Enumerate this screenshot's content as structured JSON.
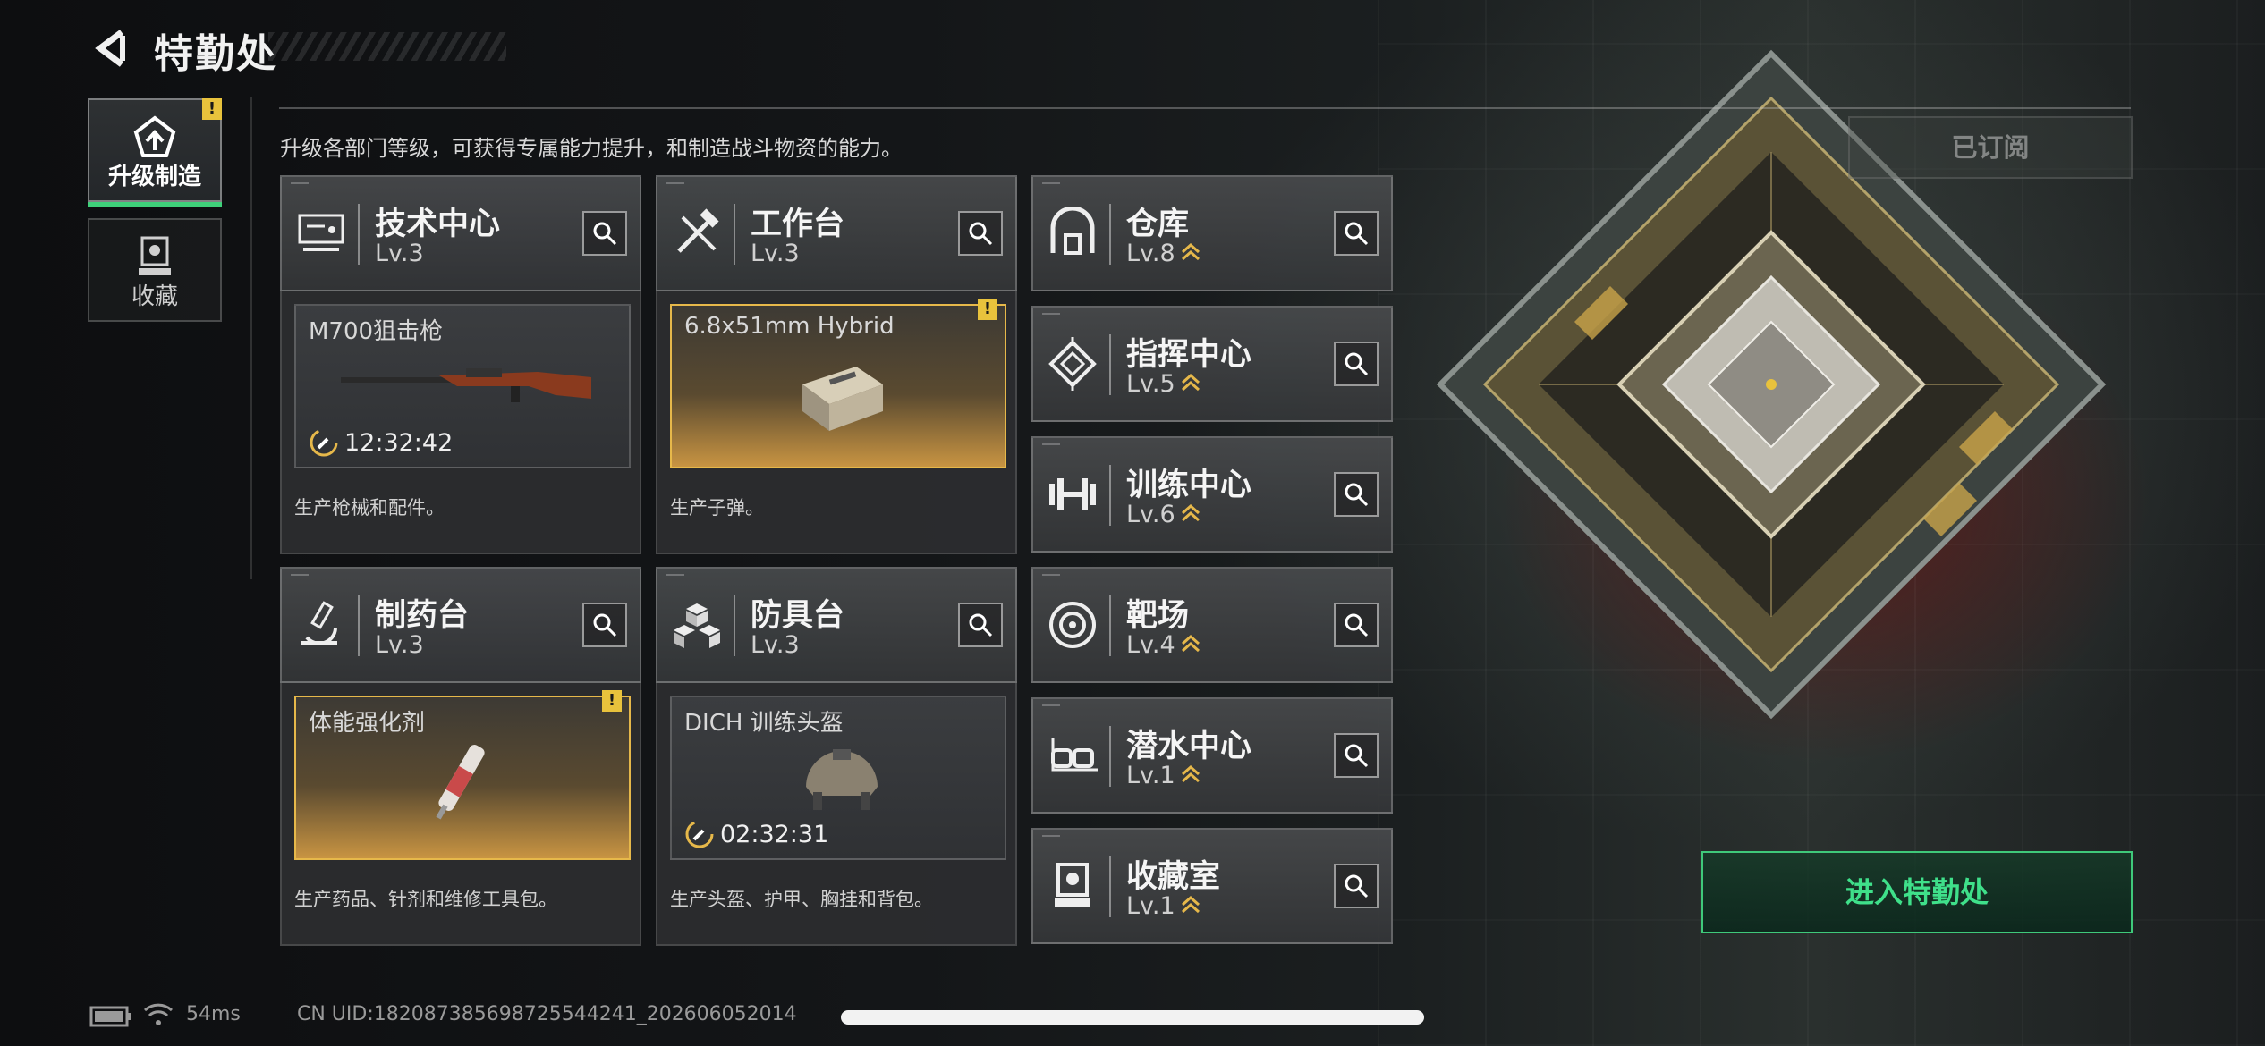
{
  "header": {
    "title": "特勤处"
  },
  "nav": [
    {
      "label": "升级制造",
      "active": true,
      "badge": "!",
      "icon": "upgrade-gear-icon"
    },
    {
      "label": "收藏",
      "active": false,
      "icon": "collection-icon"
    }
  ],
  "description": "升级各部门等级，可获得专属能力提升，和制造战斗物资的能力。",
  "departments": [
    {
      "name": "技术中心",
      "level": "Lv.3",
      "icon": "computer-icon"
    },
    {
      "name": "工作台",
      "level": "Lv.3",
      "icon": "tools-icon"
    },
    {
      "name": "仓库",
      "level": "Lv.8",
      "icon": "warehouse-icon"
    },
    {
      "name": "指挥中心",
      "level": "Lv.5",
      "icon": "command-icon"
    },
    {
      "name": "训练中心",
      "level": "Lv.6",
      "icon": "dumbbell-icon"
    },
    {
      "name": "制药台",
      "level": "Lv.3",
      "icon": "microscope-icon"
    },
    {
      "name": "防具台",
      "level": "Lv.3",
      "icon": "boxes-icon"
    },
    {
      "name": "靶场",
      "level": "Lv.4",
      "icon": "target-icon"
    },
    {
      "name": "潜水中心",
      "level": "Lv.1",
      "icon": "goggles-icon"
    },
    {
      "name": "收藏室",
      "level": "Lv.1",
      "icon": "trophy-icon"
    }
  ],
  "production": [
    {
      "item": "M700狙击枪",
      "timer": "12:32:42",
      "desc": "生产枪械和配件。",
      "highlight": false
    },
    {
      "item": "6.8x51mm Hybrid",
      "timer": "",
      "desc": "生产子弹。",
      "highlight": true,
      "badge": "!"
    },
    {
      "item": "体能强化剂",
      "timer": "",
      "desc": "生产药品、针剂和维修工具包。",
      "highlight": true,
      "badge": "!"
    },
    {
      "item": "DICH 训练头盔",
      "timer": "02:32:31",
      "desc": "生产头盔、护甲、胸挂和背包。",
      "highlight": false
    }
  ],
  "right": {
    "subscribed": "已订阅",
    "enter": "进入特勤处"
  },
  "status": {
    "ping": "54ms",
    "uid": "CN UID:18208738569872554424​1_202606052014"
  },
  "colors": {
    "accent_green": "#3fd07a",
    "highlight_gold": "#e6b84a",
    "badge_yellow": "#e8c23c"
  }
}
